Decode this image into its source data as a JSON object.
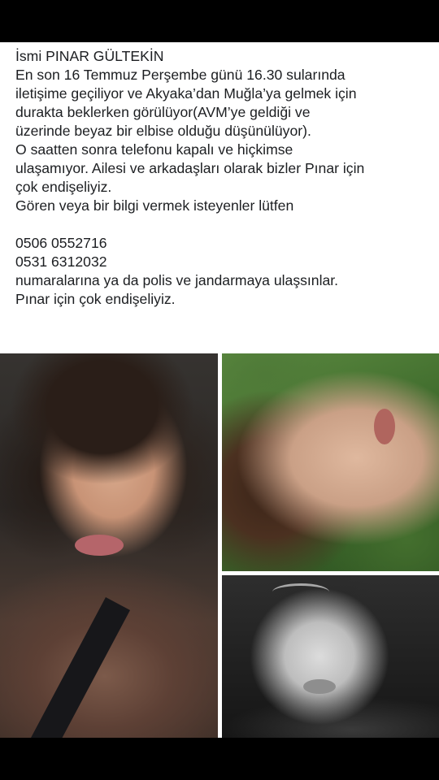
{
  "post": {
    "lines": [
      "İsmi PINAR GÜLTEKİN",
      "En son 16 Temmuz Perşembe günü 16.30 sularında",
      "iletişime geçiliyor ve Akyaka’dan Muğla’ya gelmek için",
      "durakta beklerken görülüyor(AVM’ye geldiği ve",
      "üzerinde beyaz bir elbise olduğu düşünülüyor).",
      "O saatten sonra telefonu kapalı ve hiçkimse",
      "ulaşamıyor. Ailesi ve arkadaşları olarak bizler Pınar için",
      "çok endişeliyiz.",
      "Gören veya bir bilgi vermek isteyenler lütfen",
      "",
      "0506 0552716",
      "0531 6312032",
      "numaralarına ya da polis ve jandarmaya ulaşsınlar.",
      "Pınar için çok endişeliyiz."
    ]
  },
  "photos": [
    {
      "name": "portrait-selfie-car"
    },
    {
      "name": "portrait-lying-on-grass"
    },
    {
      "name": "portrait-black-and-white"
    }
  ],
  "colors": {
    "background": "#000000",
    "post_background": "#ffffff",
    "text": "#1c1e21"
  }
}
